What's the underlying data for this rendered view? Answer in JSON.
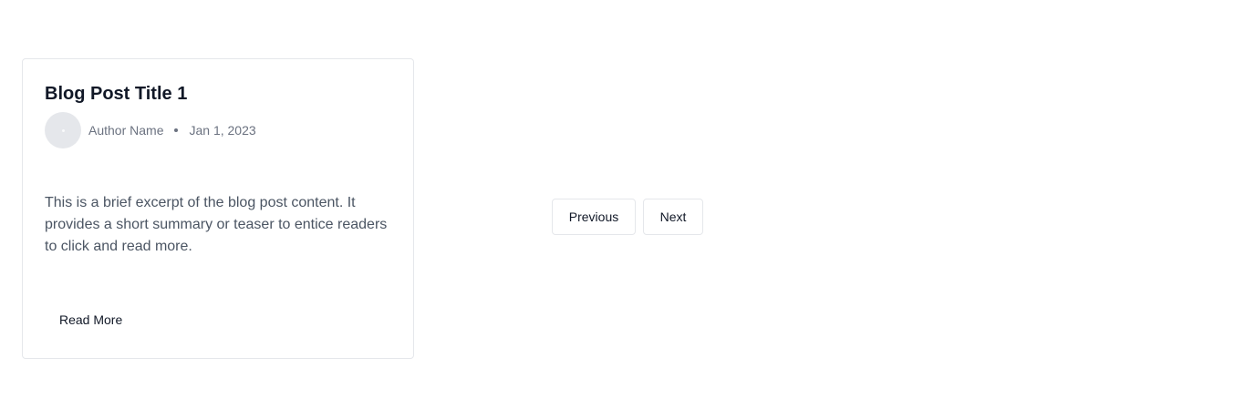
{
  "post": {
    "title": "Blog Post Title 1",
    "author": "Author Name",
    "date": "Jan 1, 2023",
    "excerpt": "This is a brief excerpt of the blog post content. It provides a short summary or teaser to entice readers to click and read more.",
    "read_more_label": "Read More"
  },
  "pagination": {
    "previous_label": "Previous",
    "next_label": "Next"
  },
  "colors": {
    "border": "#e5e7eb",
    "title": "#111827",
    "meta": "#6b7280",
    "body": "#4b5563"
  }
}
